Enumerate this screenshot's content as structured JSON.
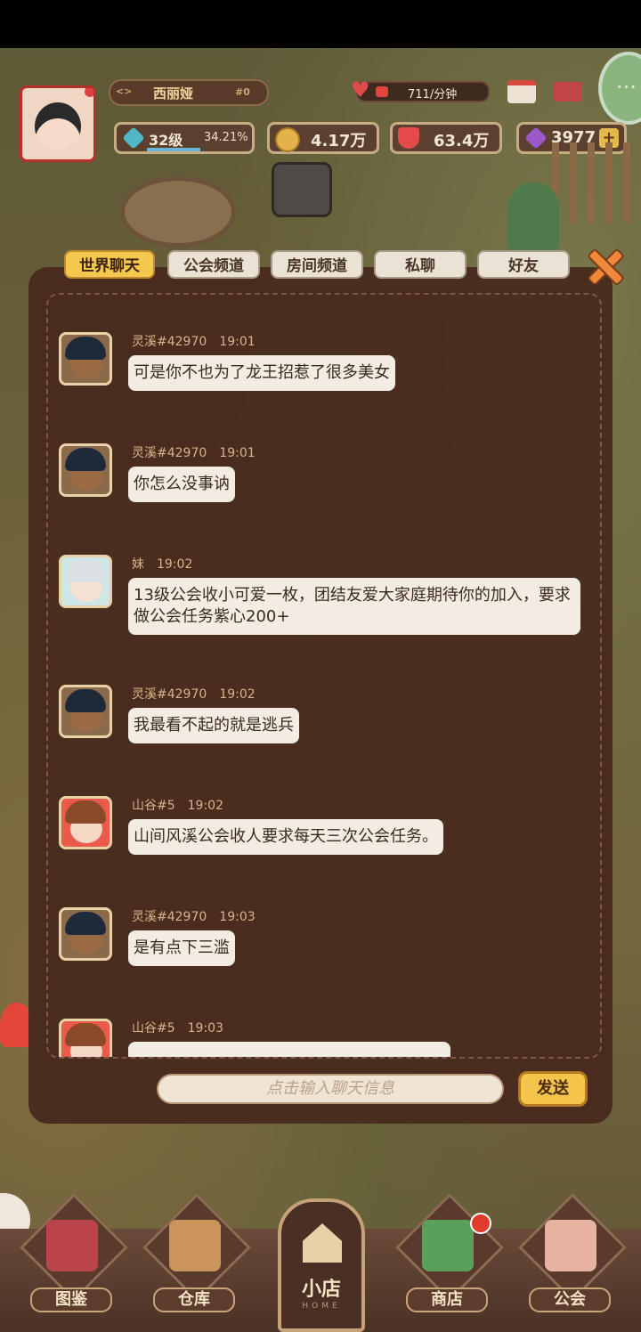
{
  "player": {
    "name": "西丽娅",
    "id": "#0",
    "heart_rate": "711/分钟",
    "level": "32级",
    "level_progress": "34.21%",
    "gold": "4.17万",
    "hearts": "63.4万",
    "gems": "3977"
  },
  "tabs": [
    "世界聊天",
    "公会频道",
    "房间频道",
    "私聊",
    "好友"
  ],
  "active_tab": "世界聊天",
  "messages": [
    {
      "name": "灵溪#42970",
      "time": "19:01",
      "text": "可是你不也为了龙王招惹了很多美女",
      "avatar": "dark-hair-boy"
    },
    {
      "name": "灵溪#42970",
      "time": "19:01",
      "text": "你怎么没事讷",
      "avatar": "dark-hair-boy"
    },
    {
      "name": "妹",
      "time": "19:02",
      "text": "13级公会收小可爱一枚，团结友爱大家庭期待你的加入，要求做公会任务紫心200+",
      "avatar": "white-hair-girl"
    },
    {
      "name": "灵溪#42970",
      "time": "19:02",
      "text": "我最看不起的就是逃兵",
      "avatar": "dark-hair-boy"
    },
    {
      "name": "山谷#5",
      "time": "19:02",
      "text": "山间风溪公会收人要求每天三次公会任务。",
      "avatar": "red-hat-boy"
    },
    {
      "name": "灵溪#42970",
      "time": "19:03",
      "text": "是有点下三滥",
      "avatar": "dark-hair-boy"
    },
    {
      "name": "山谷#5",
      "time": "19:03",
      "text": "",
      "avatar": "red-hat-boy"
    }
  ],
  "input": {
    "placeholder": "点击输入聊天信息",
    "send": "发送"
  },
  "nav": {
    "collection": "图鉴",
    "warehouse": "仓库",
    "home": "小店",
    "home_sub": "HOME",
    "shop": "商店",
    "guild": "公会"
  },
  "icons": {
    "close": "close-x-icon",
    "calendar": "calendar-icon",
    "mail": "mail-icon",
    "chat": "chat-bubble-icon"
  },
  "colors": {
    "active_tab": "#f4c84c",
    "panel": "#46281c",
    "bubble": "#f3ece3"
  }
}
